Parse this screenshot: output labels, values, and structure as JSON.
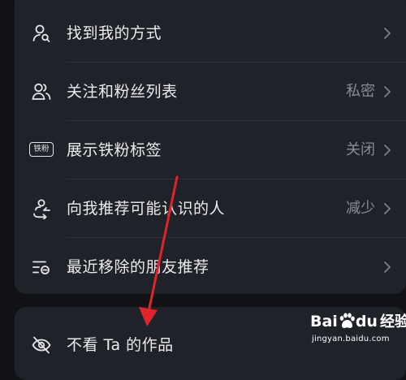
{
  "settings": {
    "rows": [
      {
        "icon": "find-me-icon",
        "label": "找到我的方式",
        "value": ""
      },
      {
        "icon": "followers-icon",
        "label": "关注和粉丝列表",
        "value": "私密"
      },
      {
        "icon": "iron-fan-badge-icon",
        "badge_text": "铁粉",
        "label": "展示铁粉标签",
        "value": "关闭"
      },
      {
        "icon": "recommend-people-icon",
        "label": "向我推荐可能认识的人",
        "value": "减少"
      },
      {
        "icon": "removed-list-icon",
        "label": "最近移除的朋友推荐",
        "value": ""
      }
    ],
    "second_card": {
      "rows": [
        {
          "icon": "eye-off-icon",
          "label": "不看 Ta 的作品"
        }
      ]
    }
  },
  "watermark": {
    "brand": "Bai",
    "brand_suffix": "du",
    "product": "经验",
    "url": "jingyan.baidu.com"
  },
  "colors": {
    "background": "#111216",
    "card": "#202229",
    "text": "#ececef",
    "secondary": "#8a8c93",
    "annotation_arrow": "#e0242a"
  }
}
